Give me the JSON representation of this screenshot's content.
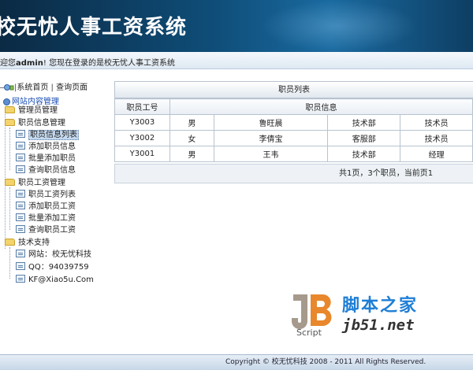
{
  "app": {
    "banner_title": "校无忧人事工资系统",
    "welcome_prefix": "迎您",
    "username": "admin",
    "welcome_suffix": "! 您现在登录的是校无忧人事工资系统"
  },
  "topnav": {
    "home_label": "系统首页",
    "query_label": "查询页面"
  },
  "tree": {
    "root_label": "网站内容管理",
    "groups": [
      {
        "label": "管理员管理"
      },
      {
        "label": "职员信息管理",
        "children": [
          "职员信息列表",
          "添加职员信息",
          "批量添加职员",
          "查询职员信息"
        ]
      },
      {
        "label": "职员工资管理",
        "children": [
          "职员工资列表",
          "添加职员工资",
          "批量添加工资",
          "查询职员工资"
        ]
      },
      {
        "label": "技术支持",
        "children": [
          "网站：校无忧科技",
          "QQ：94039759",
          "KF@Xiao5u.Com"
        ]
      }
    ]
  },
  "panel": {
    "title": "职员列表",
    "col_id": "职员工号",
    "col_info": "职员信息",
    "rows": [
      {
        "id": "Y3003",
        "gender": "男",
        "name": "鲁旺晨",
        "dept": "技术部",
        "position": "技术员"
      },
      {
        "id": "Y3002",
        "gender": "女",
        "name": "李倩宝",
        "dept": "客服部",
        "position": "技术员"
      },
      {
        "id": "Y3001",
        "gender": "男",
        "name": "王韦",
        "dept": "技术部",
        "position": "经理"
      }
    ],
    "pager": "共1页，3个职员，当前页1"
  },
  "watermark": {
    "brand_cn": "脚本之家",
    "url": "jb51.net",
    "script_label": "Script"
  },
  "footer": {
    "copyright": "Copyright © 校无忧科技  2008 - 2011 All Rights Reserved."
  }
}
